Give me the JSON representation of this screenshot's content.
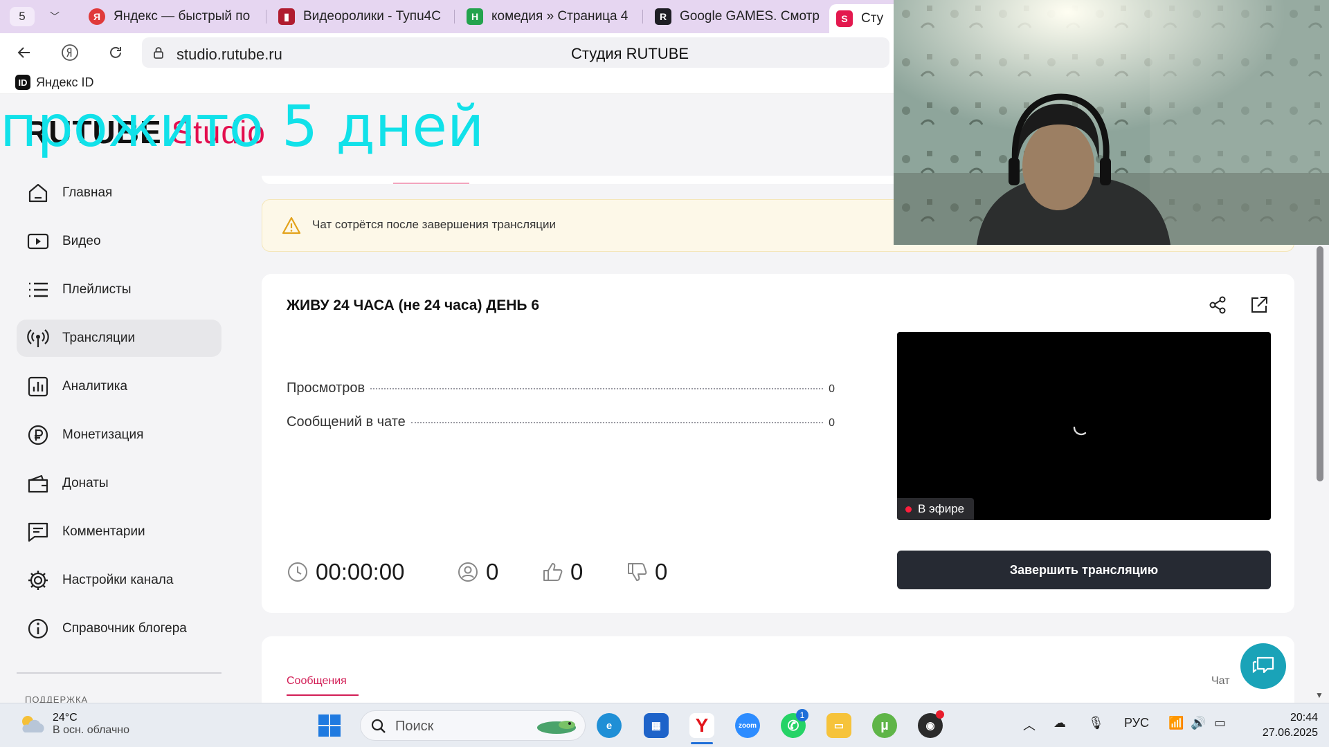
{
  "browser": {
    "tab_count": "5",
    "tabs": [
      {
        "label": "Яндекс — быстрый по",
        "favicon": "Я",
        "color": "#e03a3a"
      },
      {
        "label": "Видеоролики - Tyпu4C",
        "favicon": "▮",
        "color": "#b01c2f"
      },
      {
        "label": "комедия » Страница 4",
        "favicon": "Н",
        "color": "#23a34d"
      },
      {
        "label": "Google GAMES. Смотр",
        "favicon": "R",
        "color": "#1e1e24"
      },
      {
        "label": "Сту",
        "favicon": "S",
        "color": "#e3194e"
      }
    ],
    "url": "studio.rutube.ru",
    "page_title": "Студия RUTUBE",
    "bookmark": "Яндекс ID"
  },
  "overlay_text": "прожито 5 дней",
  "logo": {
    "brand": "RUTUBE",
    "product": "Studio"
  },
  "sidebar": {
    "items": [
      {
        "label": "Главная",
        "icon": "home-icon"
      },
      {
        "label": "Видео",
        "icon": "video-icon"
      },
      {
        "label": "Плейлисты",
        "icon": "playlist-icon"
      },
      {
        "label": "Трансляции",
        "icon": "broadcast-icon",
        "active": true
      },
      {
        "label": "Аналитика",
        "icon": "analytics-icon"
      },
      {
        "label": "Монетизация",
        "icon": "ruble-icon"
      },
      {
        "label": "Донаты",
        "icon": "wallet-icon"
      },
      {
        "label": "Комментарии",
        "icon": "comment-icon"
      },
      {
        "label": "Настройки канала",
        "icon": "gear-icon"
      },
      {
        "label": "Справочник блогера",
        "icon": "info-icon"
      }
    ],
    "support_label": "ПОДДЕРЖКА"
  },
  "warning": {
    "text": "Чат сотрётся после завершения трансляции"
  },
  "stream": {
    "title": "ЖИВУ 24 ЧАСА (не 24 часа) ДЕНЬ 6",
    "stats": [
      {
        "label": "Просмотров",
        "value": "0"
      },
      {
        "label": "Сообщений в чате",
        "value": "0"
      }
    ],
    "live_badge": "В эфире",
    "end_button": "Завершить трансляцию",
    "duration": "00:00:00",
    "viewers": "0",
    "likes": "0",
    "dislikes": "0"
  },
  "chat_panel": {
    "tab_messages": "Сообщения",
    "tab_chat": "Чат"
  },
  "taskbar": {
    "weather_temp": "24°C",
    "weather_desc": "В осн. облачно",
    "search_placeholder": "Поиск",
    "lang": "РУС",
    "time": "20:44",
    "date": "27.06.2025",
    "whatsapp_badge": "1"
  },
  "colors": {
    "accent": "#e30e4e",
    "overlay": "#11e1e9",
    "button_dark": "#262a33"
  }
}
